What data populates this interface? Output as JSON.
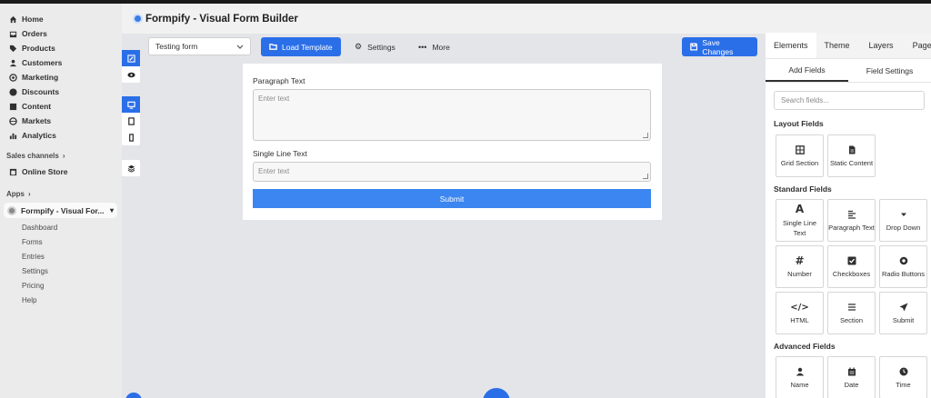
{
  "sidebar": {
    "nav": [
      {
        "label": "Home",
        "icon": "home-icon"
      },
      {
        "label": "Orders",
        "icon": "inbox-icon"
      },
      {
        "label": "Products",
        "icon": "tag-icon"
      },
      {
        "label": "Customers",
        "icon": "person-icon"
      },
      {
        "label": "Marketing",
        "icon": "target-icon"
      },
      {
        "label": "Discounts",
        "icon": "discount-icon"
      },
      {
        "label": "Content",
        "icon": "content-icon"
      },
      {
        "label": "Markets",
        "icon": "globe-icon"
      },
      {
        "label": "Analytics",
        "icon": "bar-chart-icon"
      }
    ],
    "sales_channels_label": "Sales channels",
    "online_store": "Online Store",
    "apps_label": "Apps",
    "app_name": "Formpify - Visual For...",
    "app_sub": [
      "Dashboard",
      "Forms",
      "Entries",
      "Settings",
      "Pricing",
      "Help"
    ]
  },
  "header": {
    "title": "Formpify - Visual Form Builder"
  },
  "toolbar": {
    "form_select": "Testing form",
    "load_template": "Load Template",
    "settings": "Settings",
    "more": "More",
    "save": "Save Changes"
  },
  "form": {
    "field1_label": "Paragraph Text",
    "field1_placeholder": "Enter text",
    "field2_label": "Single Line Text",
    "field2_placeholder": "Enter text",
    "submit": "Submit"
  },
  "panel": {
    "tabs": [
      "Elements",
      "Theme",
      "Layers",
      "Pages"
    ],
    "subtabs": [
      "Add Fields",
      "Field Settings"
    ],
    "search_placeholder": "Search fields...",
    "layout_title": "Layout Fields",
    "layout_fields": [
      {
        "label": "Grid Section",
        "icon": "grid-icon"
      },
      {
        "label": "Static Content",
        "icon": "document-icon"
      }
    ],
    "standard_title": "Standard Fields",
    "standard_fields": [
      {
        "label": "Single Line Text",
        "icon": "letter-a-icon"
      },
      {
        "label": "Paragraph Text",
        "icon": "align-left-icon"
      },
      {
        "label": "Drop Down",
        "icon": "caret-down-icon"
      },
      {
        "label": "Number",
        "icon": "hash-icon"
      },
      {
        "label": "Checkboxes",
        "icon": "checkbox-icon"
      },
      {
        "label": "Radio Buttons",
        "icon": "radio-icon"
      },
      {
        "label": "HTML",
        "icon": "code-icon"
      },
      {
        "label": "Section",
        "icon": "menu-icon"
      },
      {
        "label": "Submit",
        "icon": "send-icon"
      }
    ],
    "advanced_title": "Advanced Fields",
    "advanced_fields": [
      {
        "label": "Name",
        "icon": "person-icon"
      },
      {
        "label": "Date",
        "icon": "calendar-icon"
      },
      {
        "label": "Time",
        "icon": "clock-icon"
      }
    ]
  },
  "colors": {
    "accent": "#2b6fe8",
    "submit": "#3b86f0"
  }
}
